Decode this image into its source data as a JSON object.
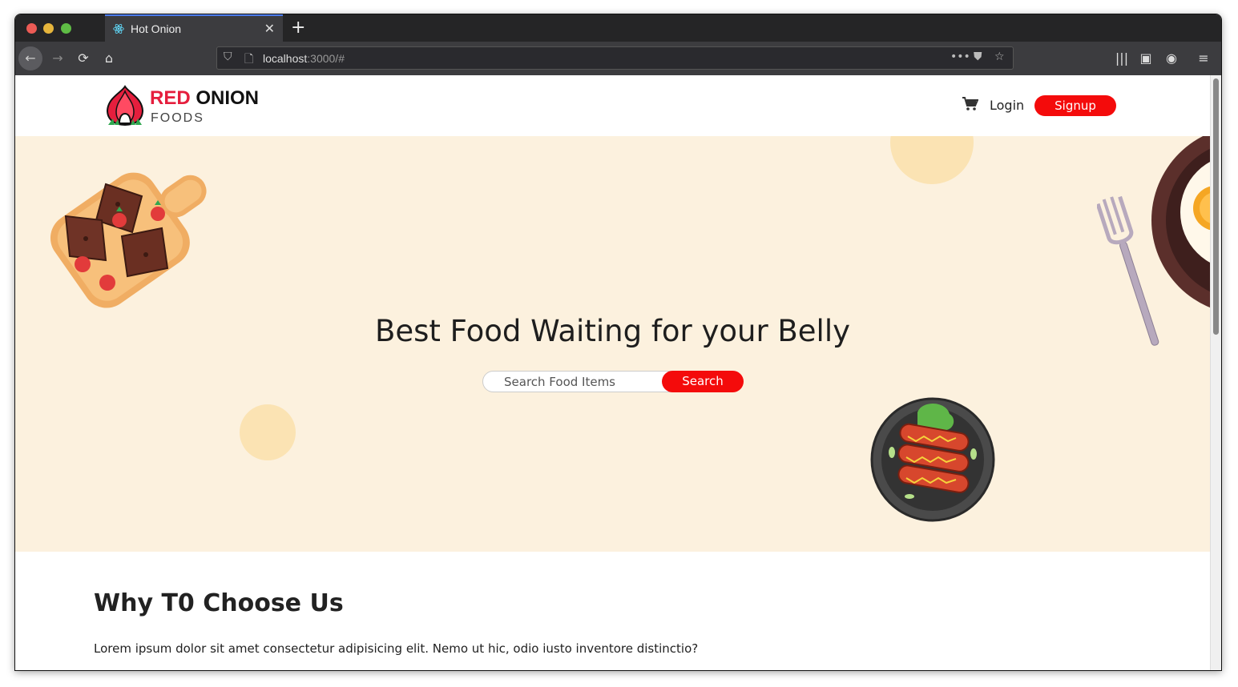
{
  "browser": {
    "tab_title": "Hot Onion",
    "new_tab_symbol": "+",
    "close_symbol": "✕",
    "url_host": "localhost",
    "url_rest": ":3000/#"
  },
  "header": {
    "logo_red": "RED",
    "logo_dark": "ONION",
    "logo_sub": "FOODS",
    "login_label": "Login",
    "signup_label": "Signup"
  },
  "hero": {
    "title": "Best Food Waiting for your Belly",
    "search_placeholder": "Search Food Items",
    "search_button": "Search"
  },
  "why": {
    "title": "Why T0 Choose Us",
    "text": "Lorem ipsum dolor sit amet consectetur adipisicing elit. Nemo ut hic, odio iusto inventore distinctio?"
  },
  "colors": {
    "accent": "#f40b0b",
    "logo_red": "#e51e3d",
    "hero_bg": "#fcf1de"
  },
  "icons": [
    "react-icon",
    "back-icon",
    "forward-icon",
    "reload-icon",
    "home-icon",
    "shield-icon",
    "page-icon",
    "more-icon",
    "pocket-icon",
    "star-icon",
    "library-icon",
    "sidebar-icon",
    "account-icon",
    "menu-icon",
    "cart-icon"
  ]
}
